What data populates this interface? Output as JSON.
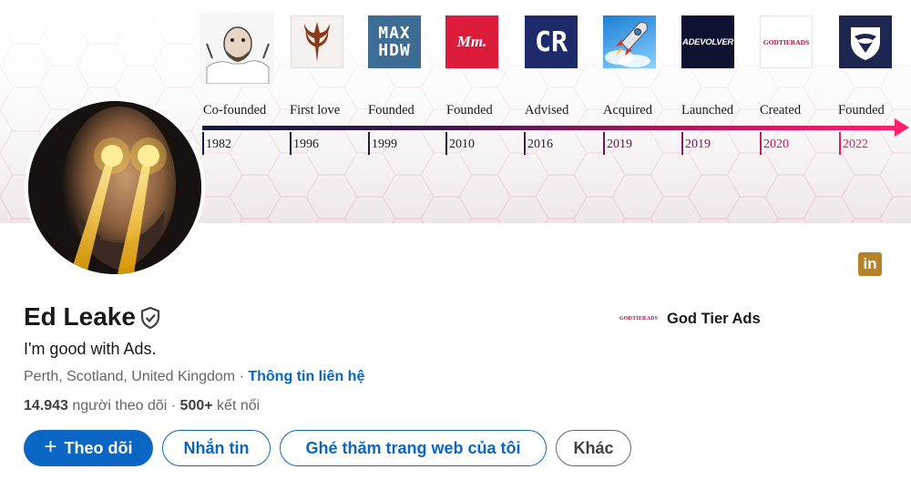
{
  "banner": {
    "timeline": [
      {
        "label": "Co-founded",
        "year": "1982",
        "logo_text": "",
        "logo_icon": "cartoon-man-icon",
        "year_color": "#1b1b1b"
      },
      {
        "label": "First love",
        "year": "1996",
        "logo_text": "",
        "logo_icon": "quake-icon",
        "year_color": "#1b1b1b"
      },
      {
        "label": "Founded",
        "year": "1999",
        "logo_text": "MAX\nHDW",
        "logo_icon": "max-hdw-logo",
        "year_color": "#1b1b1b"
      },
      {
        "label": "Founded",
        "year": "2010",
        "logo_text": "Mm.",
        "logo_icon": "mm-logo",
        "year_color": "#1b1b1b"
      },
      {
        "label": "Advised",
        "year": "2016",
        "logo_text": "CR",
        "logo_icon": "cr-logo",
        "year_color": "#2a1838"
      },
      {
        "label": "Acquired",
        "year": "2019",
        "logo_text": "",
        "logo_icon": "rocket-icon",
        "year_color": "#5a1848"
      },
      {
        "label": "Launched",
        "year": "2019",
        "logo_text": "ADEVOLVER",
        "logo_icon": "adevolver-logo",
        "year_color": "#7a1850"
      },
      {
        "label": "Created",
        "year": "2020",
        "logo_text": "GODTIERADS",
        "logo_icon": "godtierads-logo",
        "year_color": "#c01a5c"
      },
      {
        "label": "Founded",
        "year": "2022",
        "logo_text": "",
        "logo_icon": "eagle-shield-icon",
        "year_color": "#e01a64"
      }
    ]
  },
  "profile": {
    "name": "Ed Leake",
    "headline": "I'm good with Ads.",
    "location": "Perth, Scotland, United Kingdom",
    "separator": " · ",
    "contact_info": "Thông tin liên hệ",
    "followers_count": "14.943",
    "followers_label": " người theo dõi",
    "connections_count": "500+",
    "connections_label": " kết nối",
    "stats_separator": " · "
  },
  "company": {
    "logo_text": "GODTIERADS",
    "name": "God Tier Ads"
  },
  "social": {
    "linkedin_badge": "in"
  },
  "actions": {
    "follow": "Theo dõi",
    "follow_icon": "+",
    "message": "Nhắn tin",
    "visit_website": "Ghé thăm trang web của tôi",
    "more": "Khác"
  },
  "colors": {
    "primary": "#0a66c2",
    "linkedin_badge": "#b7812a",
    "timeline_start": "#141a3c",
    "timeline_end": "#ff1f6e"
  }
}
